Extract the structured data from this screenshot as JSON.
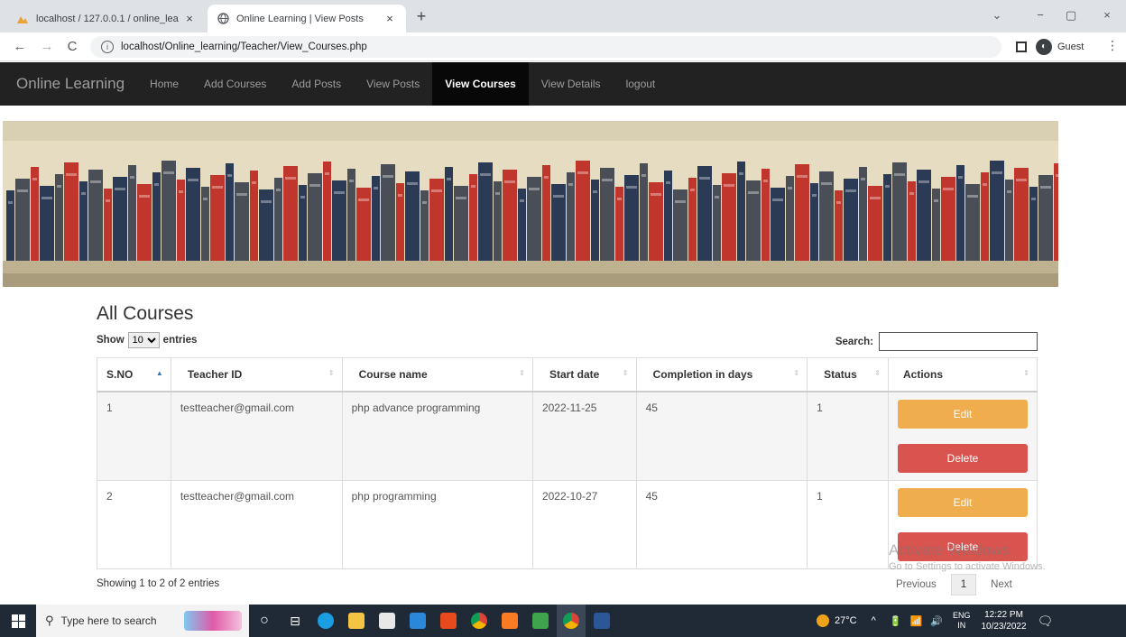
{
  "browser": {
    "tabs": [
      {
        "title": "localhost / 127.0.0.1 / online_lea",
        "active": false
      },
      {
        "title": "Online Learning | View Posts",
        "active": true
      }
    ],
    "url": "localhost/Online_learning/Teacher/View_Courses.php",
    "profile": "Guest",
    "icons": {
      "back": "←",
      "forward": "→",
      "reload": "C",
      "info": "i",
      "menu": "⋮",
      "new_tab": "+",
      "close": "×",
      "minimize": "−",
      "restore": "▢",
      "collapse": "⌄",
      "profile_avatar": "◐"
    }
  },
  "navbar": {
    "brand": "Online Learning",
    "links": [
      "Home",
      "Add Courses",
      "Add Posts",
      "View Posts",
      "View Courses",
      "View Details",
      "logout"
    ],
    "active": "View Courses"
  },
  "page": {
    "title": "All Courses",
    "show_label": "Show",
    "entries_label": "entries",
    "page_length": "10",
    "search_label": "Search:",
    "search_value": ""
  },
  "table": {
    "headers": [
      "S.NO",
      "Teacher ID",
      "Course name",
      "Start date",
      "Completion in days",
      "Status",
      "Actions"
    ],
    "rows": [
      {
        "sno": "1",
        "teacher": "testteacher@gmail.com",
        "course": "php advance programming",
        "start": "2022-11-25",
        "days": "45",
        "status": "1"
      },
      {
        "sno": "2",
        "teacher": "testteacher@gmail.com",
        "course": "php programming",
        "start": "2022-10-27",
        "days": "45",
        "status": "1"
      }
    ],
    "edit_label": "Edit",
    "delete_label": "Delete",
    "sort_icons": {
      "asc": "▲",
      "both": "⇕"
    }
  },
  "footer": {
    "info": "Showing 1 to 2 of 2 entries",
    "prev": "Previous",
    "current_page": "1",
    "next": "Next"
  },
  "watermark": {
    "line1": "Activate Windows",
    "line2": "Go to Settings to activate Windows."
  },
  "taskbar": {
    "search_placeholder": "Type here to search",
    "search_icon": "⚲",
    "taskview_icon": "○",
    "widgets_icon": "⊟",
    "tray_arrow": "^",
    "tray_icons": "🔋 📶 🔊",
    "notification_icon": "🗨",
    "weather": "27°C",
    "lang1": "ENG",
    "lang2": "IN",
    "time": "12:22 PM",
    "date": "10/23/2022"
  },
  "colors": {
    "navbar_bg": "#222222",
    "edit": "#f0ad4e",
    "delete": "#d9534f",
    "taskbar": "#1f2a36"
  }
}
